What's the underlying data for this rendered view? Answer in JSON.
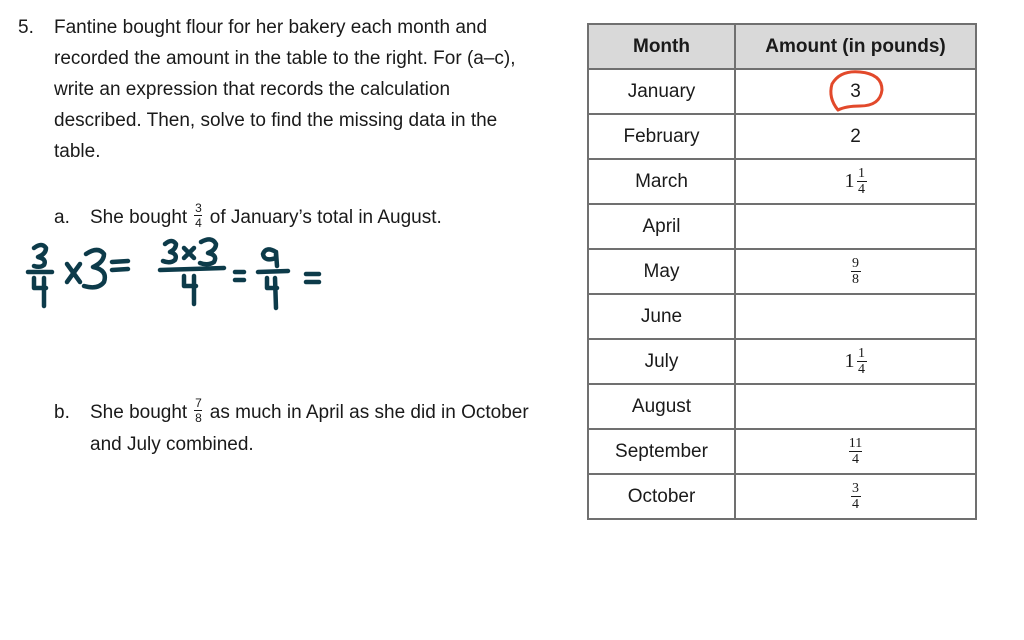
{
  "problem": {
    "number": "5.",
    "stem_lines": [
      "Fantine bought flour for her bakery each month and",
      "recorded the amount in the table to the right.  For (a–c),",
      "write an expression that records the calculation",
      "described.  Then, solve to find the missing data in the",
      "table."
    ]
  },
  "parts": {
    "a": {
      "letter": "a.",
      "before": "She bought",
      "fraction": {
        "n": "3",
        "d": "4"
      },
      "after": "of January’s total in August."
    },
    "b": {
      "letter": "b.",
      "before": "She bought",
      "fraction": {
        "n": "7",
        "d": "8"
      },
      "after_line1": "as much in April as she did in October",
      "line2": "and July combined."
    }
  },
  "handwriting": {
    "ink_color": "#0d3b4a",
    "expression": "3/4 × 3 = (3×3)/4 = 9/4 =",
    "t1n": "3",
    "t1d": "4",
    "times": "×3=",
    "t2n": "3×3",
    "t2d": "4",
    "eq2": "=",
    "t3n": "9",
    "t3d": "4",
    "eq3": "="
  },
  "table": {
    "headers": [
      "Month",
      "Amount (in pounds)"
    ],
    "header_bg": "#d9d9d9",
    "rows": [
      {
        "month": "January",
        "amount": {
          "type": "int",
          "v": "3"
        },
        "circled": true
      },
      {
        "month": "February",
        "amount": {
          "type": "int",
          "v": "2"
        }
      },
      {
        "month": "March",
        "amount": {
          "type": "mixed",
          "w": "1",
          "n": "1",
          "d": "4"
        }
      },
      {
        "month": "April",
        "amount": {
          "type": "empty"
        }
      },
      {
        "month": "May",
        "amount": {
          "type": "frac",
          "n": "9",
          "d": "8"
        }
      },
      {
        "month": "June",
        "amount": {
          "type": "empty"
        }
      },
      {
        "month": "July",
        "amount": {
          "type": "mixed",
          "w": "1",
          "n": "1",
          "d": "4"
        }
      },
      {
        "month": "August",
        "amount": {
          "type": "empty"
        }
      },
      {
        "month": "September",
        "amount": {
          "type": "frac",
          "n": "11",
          "d": "4"
        }
      },
      {
        "month": "October",
        "amount": {
          "type": "frac",
          "n": "3",
          "d": "4"
        }
      }
    ],
    "circle_color": "#e2492b"
  }
}
